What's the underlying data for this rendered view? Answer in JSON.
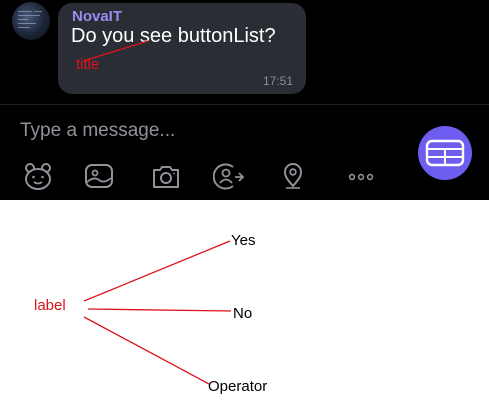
{
  "chat": {
    "sender": "NovaIT",
    "message": "Do you see buttonList?",
    "time": "17:51"
  },
  "composer": {
    "placeholder": "Type a message...",
    "tools": [
      "sticker-icon",
      "image-icon",
      "camera-icon",
      "share-contact-icon",
      "location-icon",
      "more-icon"
    ],
    "keyboard_button_icon": "button-keyboard-icon"
  },
  "annotations": {
    "title_label": "title",
    "label_label": "label",
    "options": [
      "Yes",
      "No",
      "Operator"
    ]
  },
  "colors": {
    "chat_background": "#000000",
    "bubble": "#2a2d34",
    "sender": "#9b8cf2",
    "accent": "#6e5ef0",
    "annotation": "#e0121b"
  }
}
